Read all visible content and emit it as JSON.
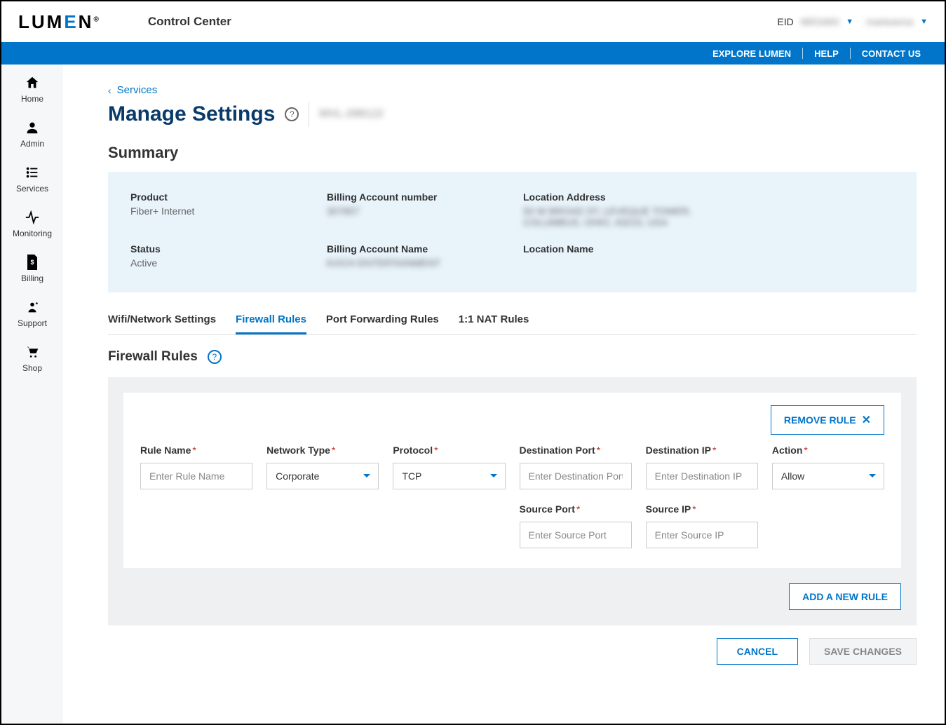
{
  "header": {
    "app_title": "Control Center",
    "eid_label": "EID",
    "eid_value": "8853483",
    "username": "marteanna"
  },
  "bluebar": {
    "explore": "EXPLORE LUMEN",
    "help": "HELP",
    "contact": "CONTACT US"
  },
  "sidebar": [
    {
      "label": "Home",
      "name": "home"
    },
    {
      "label": "Admin",
      "name": "admin"
    },
    {
      "label": "Services",
      "name": "services"
    },
    {
      "label": "Monitoring",
      "name": "monitoring"
    },
    {
      "label": "Billing",
      "name": "billing"
    },
    {
      "label": "Support",
      "name": "support"
    },
    {
      "label": "Shop",
      "name": "shop"
    }
  ],
  "breadcrumb": {
    "label": "Services"
  },
  "page": {
    "title": "Manage Settings",
    "subtitle": "MVL-288122"
  },
  "summary": {
    "heading": "Summary",
    "product": {
      "label": "Product",
      "value": "Fiber+ Internet"
    },
    "status": {
      "label": "Status",
      "value": "Active"
    },
    "ban": {
      "label": "Billing Account number",
      "value": "307857"
    },
    "baname": {
      "label": "Billing Account Name",
      "value": "KOCH ENTERTAINMENT"
    },
    "locaddr": {
      "label": "Location Address",
      "value1": "50 W BROAD ST, LEVEQUE TOWER,",
      "value2": "COLUMBUS, OHIO, 43215, USA"
    },
    "locname": {
      "label": "Location Name",
      "value": ""
    }
  },
  "tabs": [
    {
      "label": "Wifi/Network Settings",
      "active": false
    },
    {
      "label": "Firewall Rules",
      "active": true
    },
    {
      "label": "Port Forwarding Rules",
      "active": false
    },
    {
      "label": "1:1 NAT Rules",
      "active": false
    }
  ],
  "section": {
    "title": "Firewall Rules"
  },
  "rule_card": {
    "remove_label": "REMOVE RULE",
    "fields": {
      "rule_name": {
        "label": "Rule Name",
        "placeholder": "Enter Rule Name"
      },
      "network": {
        "label": "Network Type",
        "value": "Corporate"
      },
      "protocol": {
        "label": "Protocol",
        "value": "TCP"
      },
      "dest_port": {
        "label": "Destination Port",
        "placeholder": "Enter Destination Port"
      },
      "dest_ip": {
        "label": "Destination IP",
        "placeholder": "Enter Destination IP"
      },
      "action": {
        "label": "Action",
        "value": "Allow"
      },
      "src_port": {
        "label": "Source Port",
        "placeholder": "Enter Source Port"
      },
      "src_ip": {
        "label": "Source IP",
        "placeholder": "Enter Source IP"
      }
    }
  },
  "buttons": {
    "add_rule": "ADD A NEW RULE",
    "cancel": "CANCEL",
    "save": "SAVE CHANGES"
  }
}
